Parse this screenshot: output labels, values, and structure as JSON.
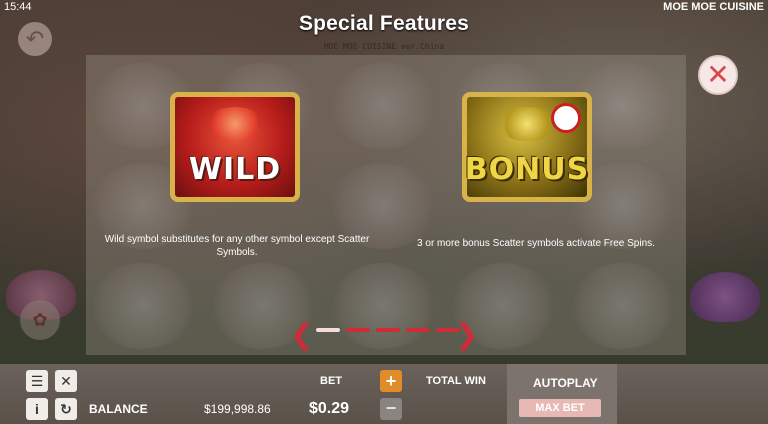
{
  "status_bar": {
    "time": "15:44",
    "game_name": "MOE MOE CUISINE"
  },
  "header": {
    "title": "Special Features",
    "logo_subtitle": "MOE MOE CUISINE ver.China"
  },
  "features": [
    {
      "symbol_label": "WILD",
      "description": "Wild symbol substitutes for any other symbol except Scatter Symbols."
    },
    {
      "symbol_label": "BONUS",
      "description": "3 or more bonus Scatter symbols activate Free Spins."
    }
  ],
  "pager": {
    "pages": 5,
    "current": 1
  },
  "controls": {
    "balance_label": "BALANCE",
    "balance_value": "$199,998.86",
    "bet_label": "BET",
    "bet_value": "$0.29",
    "bet_increase": "+",
    "bet_decrease": "−",
    "total_win_label": "TOTAL WIN",
    "autoplay_label": "AUTOPLAY",
    "max_bet_label": "MAX BET"
  },
  "icons": {
    "close": "close-icon",
    "back": "back-icon",
    "menu": "menu-icon",
    "sound": "sound-muted-icon",
    "info": "info-icon",
    "history": "history-icon",
    "prev": "arrow-left-icon",
    "next": "arrow-right-icon"
  },
  "colors": {
    "accent_red": "#d22b38",
    "gold": "#d8b34a",
    "bet_plus": "#e08c28",
    "max_bet": "#e8b9b4"
  }
}
